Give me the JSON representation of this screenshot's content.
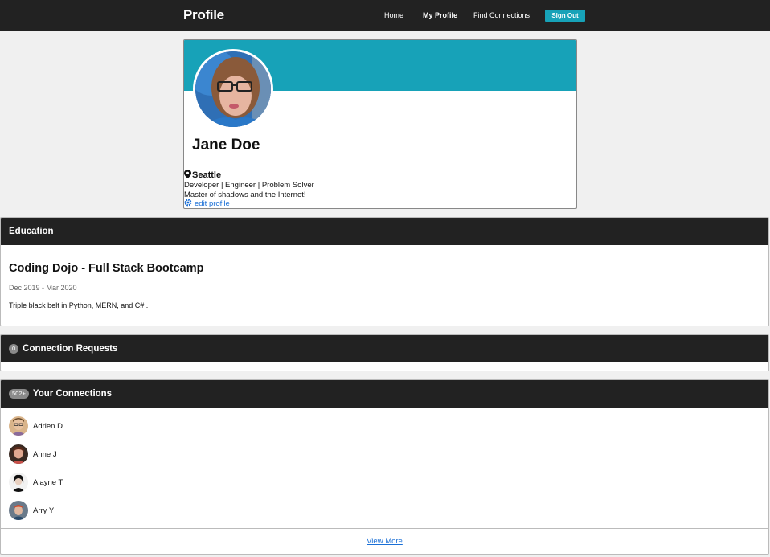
{
  "nav": {
    "brand": "Profile",
    "links": [
      "Home",
      "My Profile",
      "Find Connections"
    ],
    "signout": "Sign Out"
  },
  "profile": {
    "name": "Jane Doe",
    "location": "Seattle",
    "tagline": "Developer | Engineer | Problem Solver",
    "bio": "Master of shadows and the Internet!",
    "edit_label": "edit profile"
  },
  "education": {
    "header": "Education",
    "school": "Coding Dojo - Full Stack Bootcamp",
    "dates": "Dec 2019 - Mar 2020",
    "description": "Triple black belt in Python, MERN, and C#..."
  },
  "requests": {
    "header": "Connection Requests",
    "count": "0"
  },
  "connections": {
    "header": "Your Connections",
    "count": "502+",
    "items": [
      {
        "name": "Adrien D",
        "icon": "avatar-adrien"
      },
      {
        "name": "Anne J",
        "icon": "avatar-anne"
      },
      {
        "name": "Alayne T",
        "icon": "avatar-alayne"
      },
      {
        "name": "Arry Y",
        "icon": "avatar-arry"
      }
    ],
    "view_more": "View More"
  },
  "colors": {
    "accent": "#17a2b8",
    "navbar": "#222222",
    "link": "#1a6fd6"
  }
}
